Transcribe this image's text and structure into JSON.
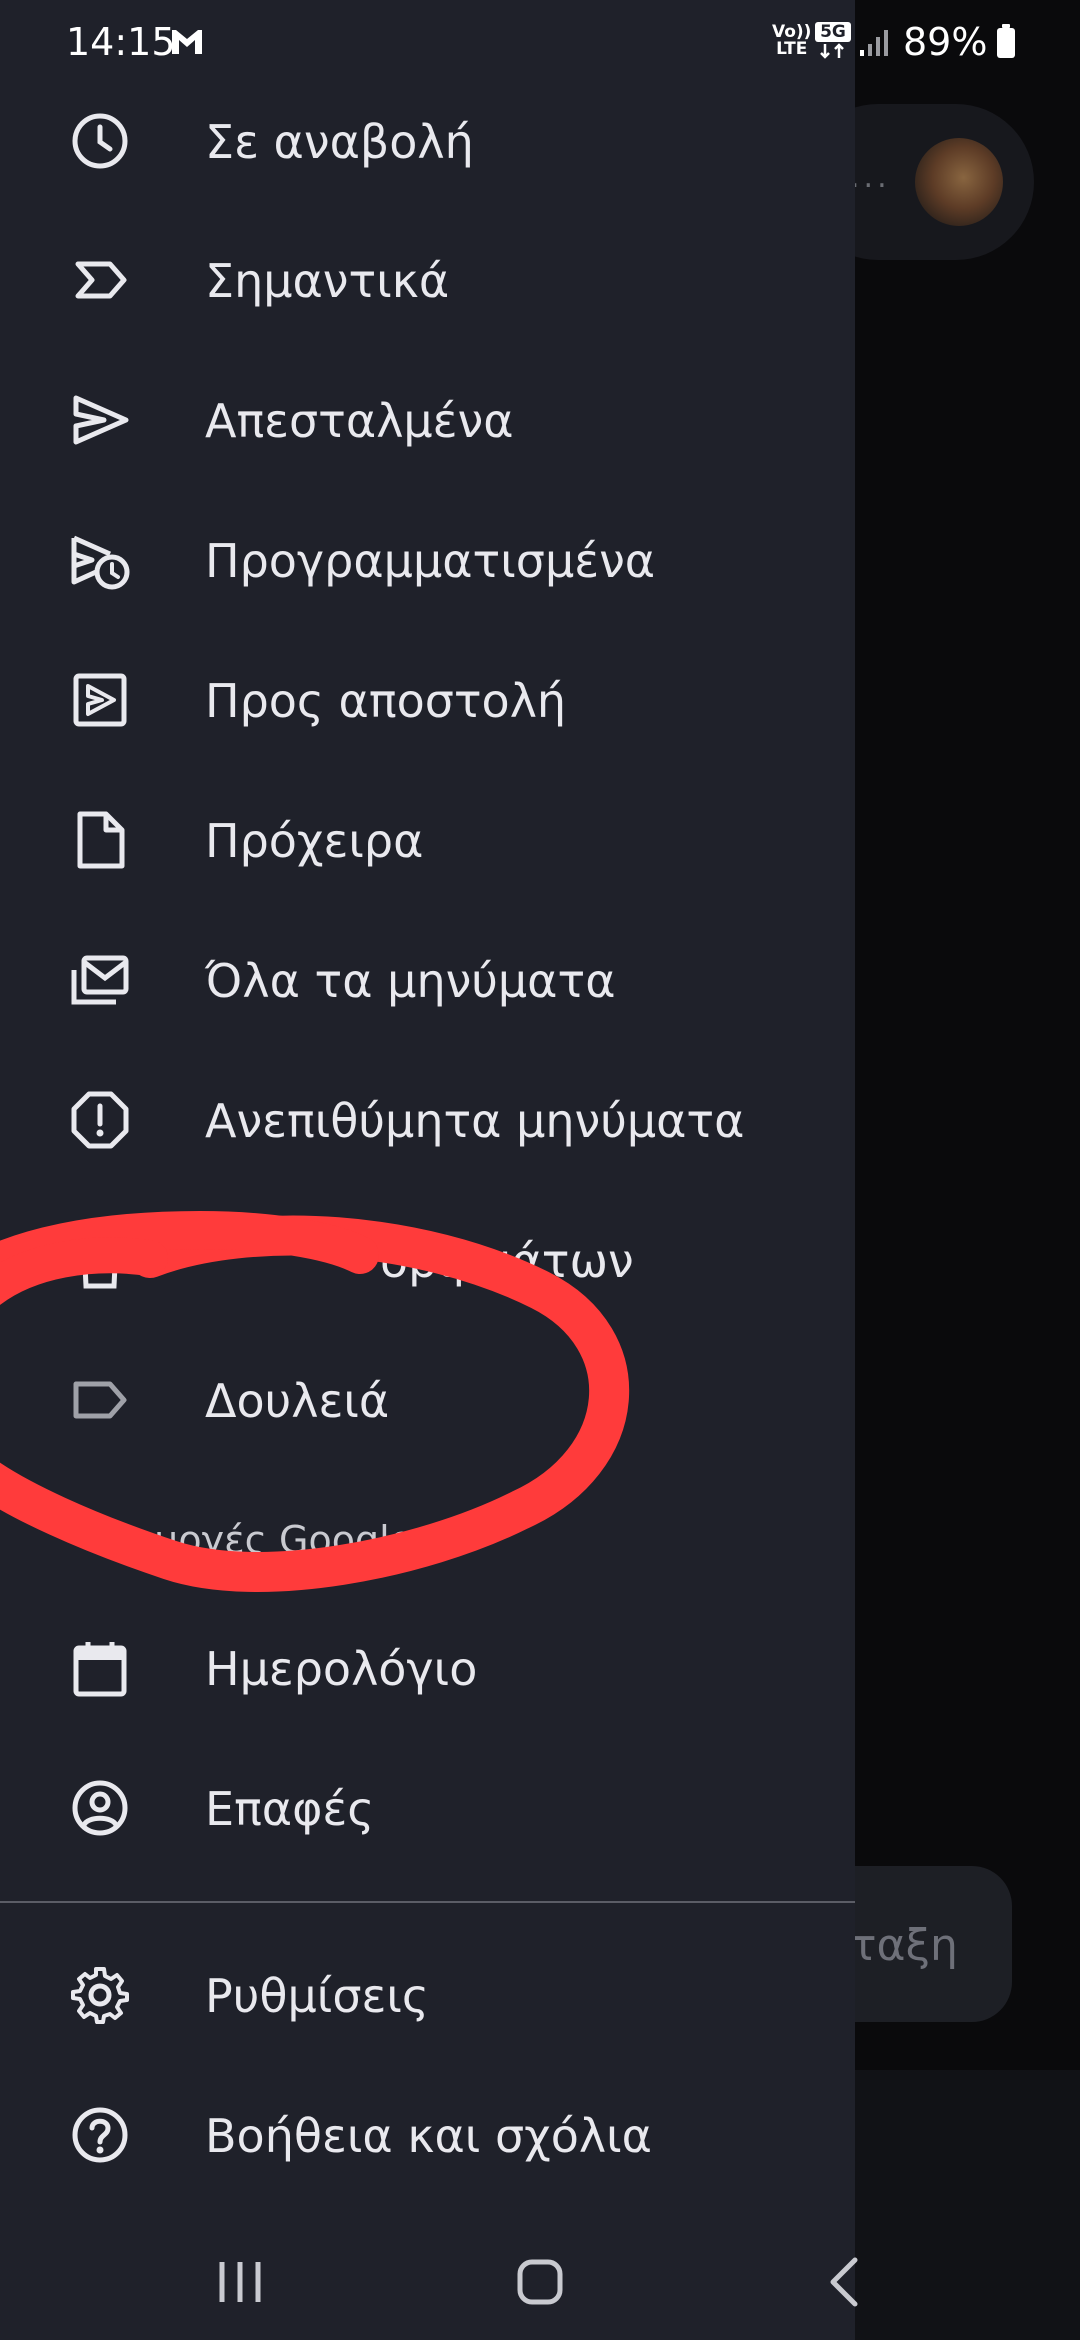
{
  "status_bar": {
    "time": "14:15",
    "volte_top": "Vo))",
    "volte_bottom": "LTE",
    "network": "5G",
    "battery_percent": "89%",
    "battery_level": 0.89
  },
  "drawer": {
    "items": [
      {
        "label": "Σε αναβολή",
        "icon": "clock-icon"
      },
      {
        "label": "Σημαντικά",
        "icon": "important-icon"
      },
      {
        "label": "Απεσταλμένα",
        "icon": "send-icon"
      },
      {
        "label": "Προγραμματισμένα",
        "icon": "scheduled-send-icon"
      },
      {
        "label": "Προς αποστολή",
        "icon": "outbox-icon"
      },
      {
        "label": "Πρόχειρα",
        "icon": "draft-icon"
      },
      {
        "label": "Όλα τα μηνύματα",
        "icon": "all-mail-icon"
      },
      {
        "label": "Ανεπιθύμητα μηνύματα",
        "icon": "spam-icon"
      },
      {
        "label": "οριμμάτων",
        "icon": "trash-icon"
      }
    ],
    "labels_items": [
      {
        "label": "Δουλειά",
        "icon": "label-icon"
      }
    ],
    "apps_section_title": "αρμογές Google",
    "apps_items": [
      {
        "label": "Ημερολόγιο",
        "icon": "calendar-icon"
      },
      {
        "label": "Επαφές",
        "icon": "contacts-icon"
      }
    ],
    "footer_items": [
      {
        "label": "Ρυθμίσεις",
        "icon": "gear-icon"
      },
      {
        "label": "Βοήθεια και σχόλια",
        "icon": "help-icon"
      }
    ]
  },
  "background": {
    "compose_label": "ταξη",
    "search_more": "..."
  },
  "colors": {
    "drawer_bg": "#1f212a",
    "text": "#e9e9ee",
    "annotation": "#ff3b3b"
  }
}
